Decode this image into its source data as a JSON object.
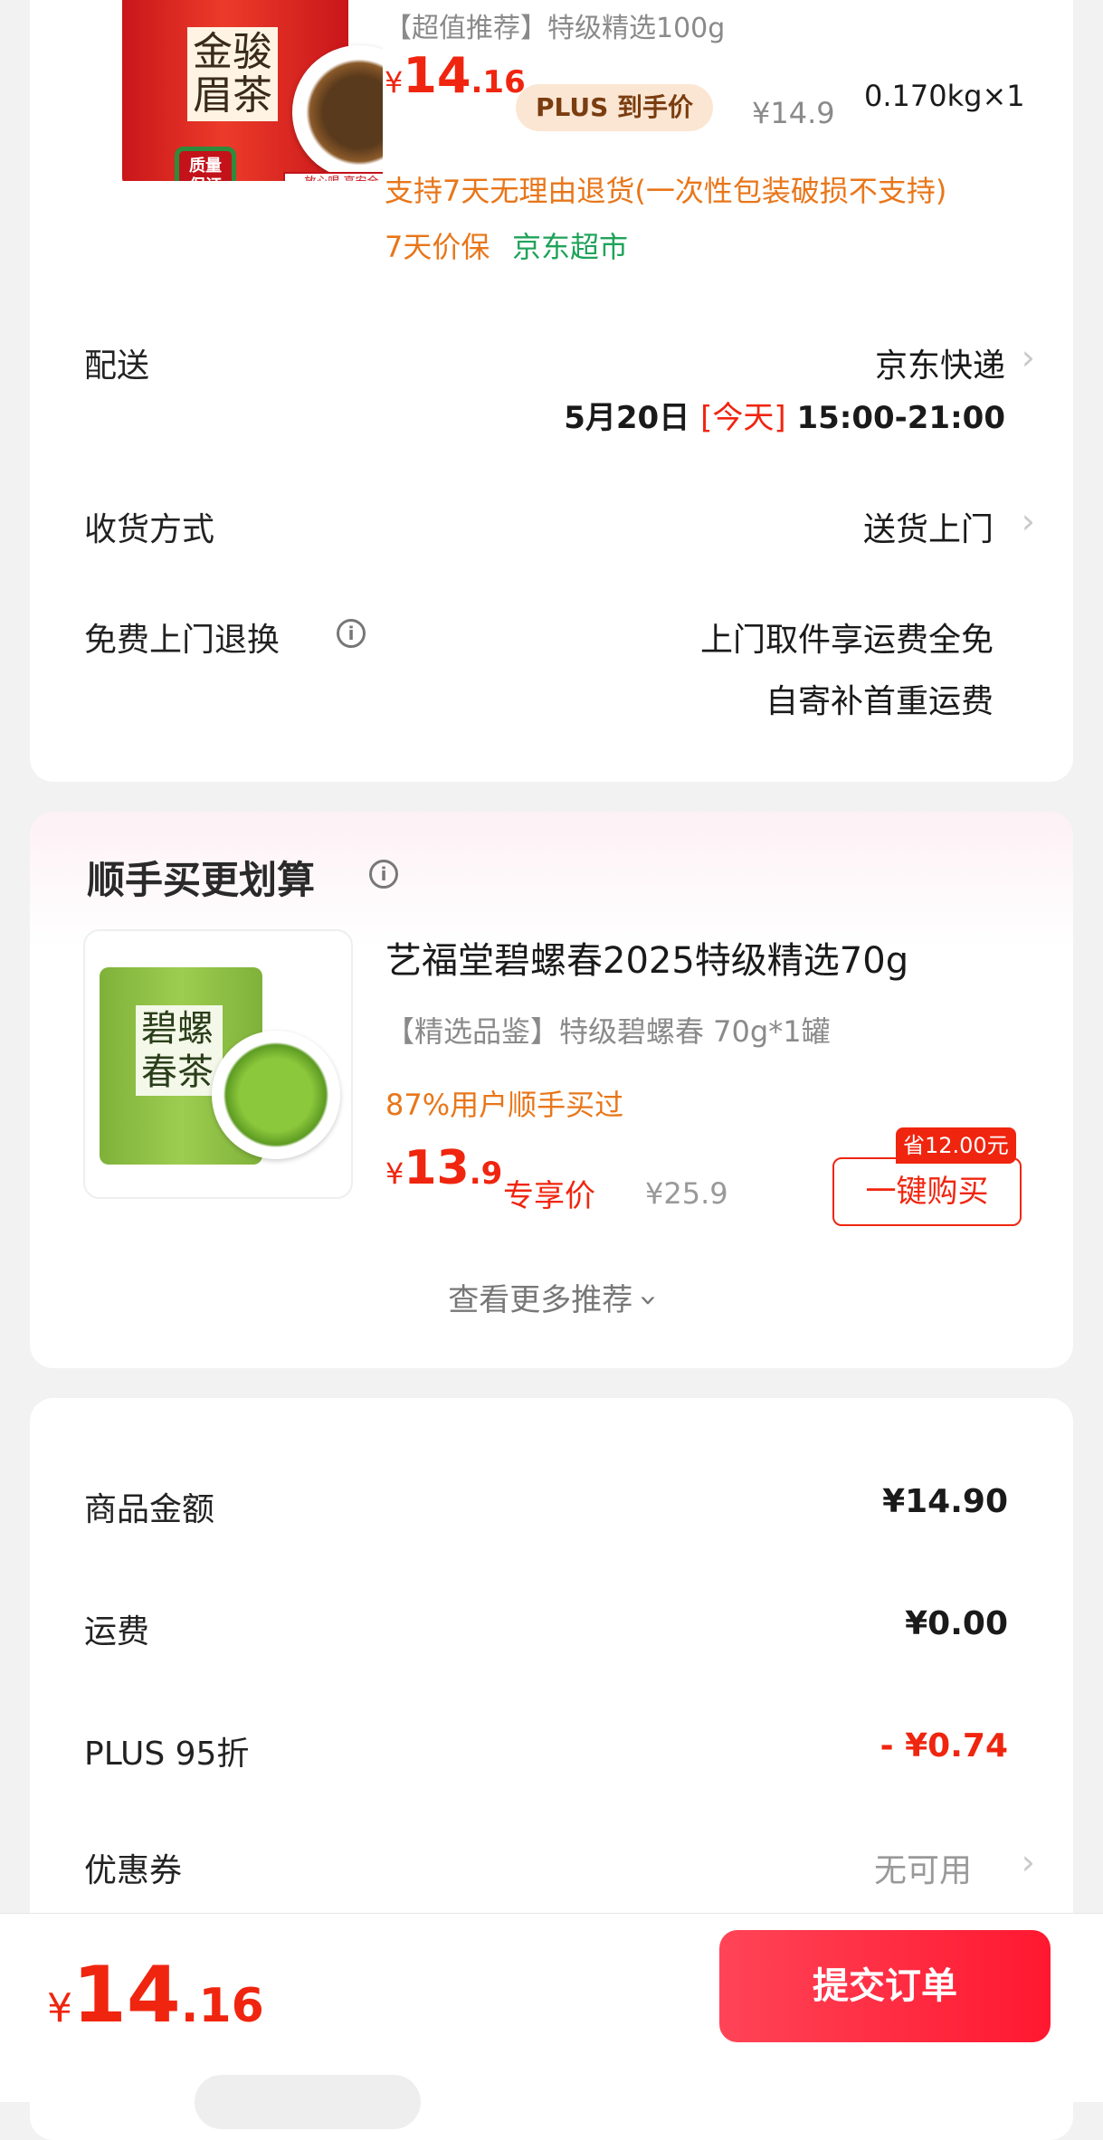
{
  "product": {
    "image_alt": "金骏眉茶 特级",
    "image_text": "金骏眉茶",
    "badge_text": "质量保证",
    "strip_text": "放心喝 高安全 性价比",
    "subtitle": "【超值推荐】特级精选100g",
    "price_currency": "¥",
    "price_int": "14",
    "price_dec": ".16",
    "plus_tag": "PLUS 到手价",
    "original_price": "¥14.9",
    "weight_qty": "0.170kg×1",
    "return_policy": "支持7天无理由退货(一次性包装破损不支持)",
    "price_protect": "7天价保",
    "store_tag": "京东超市"
  },
  "delivery": {
    "label": "配送",
    "carrier": "京东快递",
    "date": "5月20日",
    "today": "[今天]",
    "time": "15:00-21:00"
  },
  "receive": {
    "label": "收货方式",
    "value": "送货上门"
  },
  "free_return": {
    "label": "免费上门退换",
    "line1": "上门取件享运费全免",
    "line2": "自寄补首重运费"
  },
  "bundle": {
    "section_title": "顺手买更划算",
    "image_text": "碧螺春茶",
    "name": "艺福堂碧螺春2025特级精选70g",
    "spec": "【精选品鉴】特级碧螺春 70g*1罐",
    "popularity": "87%用户顺手买过",
    "price_currency": "¥",
    "price_int": "13",
    "price_dec": ".9",
    "price_tag": "专享价",
    "original_price": "¥25.9",
    "save_tag": "省12.00元",
    "buy_label": "一键购买",
    "more_label": "查看更多推荐"
  },
  "summary": {
    "rows": [
      {
        "label": "商品金额",
        "value": "¥14.90"
      },
      {
        "label": "运费",
        "value": "¥0.00"
      },
      {
        "label": "PLUS 95折",
        "value": "- ¥0.74"
      },
      {
        "label": "优惠券",
        "value": "无可用"
      }
    ]
  },
  "bottom": {
    "currency": "¥",
    "total_int": "14",
    "total_dec": ".16",
    "submit_label": "提交订单"
  },
  "colors": {
    "price_red": "#f0250f",
    "green": "#1fa35a",
    "orange": "#e8761a",
    "plus_bg": "#fbe6d3"
  }
}
